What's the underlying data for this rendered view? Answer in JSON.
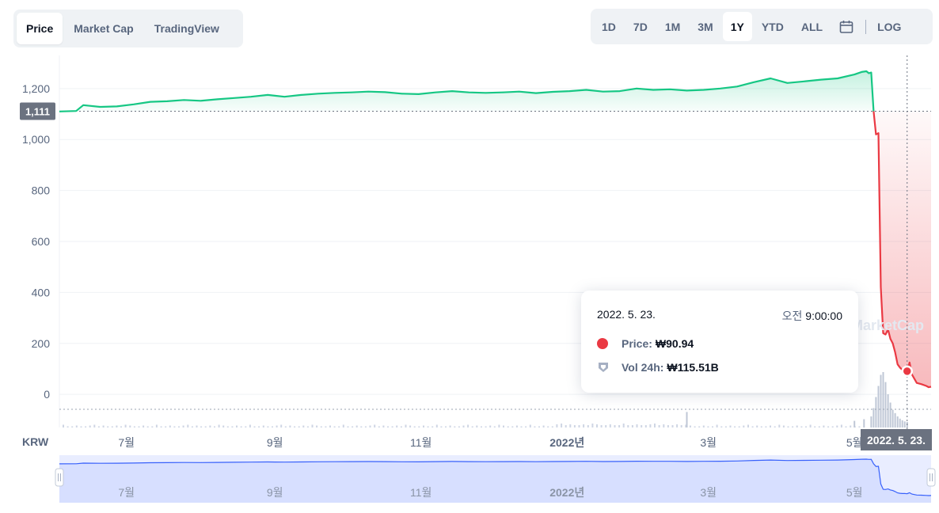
{
  "tabs": [
    {
      "label": "Price",
      "active": true
    },
    {
      "label": "Market Cap",
      "active": false
    },
    {
      "label": "TradingView",
      "active": false
    }
  ],
  "ranges": [
    {
      "label": "1D",
      "active": false
    },
    {
      "label": "7D",
      "active": false
    },
    {
      "label": "1M",
      "active": false
    },
    {
      "label": "3M",
      "active": false
    },
    {
      "label": "1Y",
      "active": true
    },
    {
      "label": "YTD",
      "active": false
    },
    {
      "label": "ALL",
      "active": false
    }
  ],
  "log_label": "LOG",
  "calendar_icon": "calendar-icon",
  "colors": {
    "up": "#16c784",
    "down": "#ea3943",
    "navigator": "#3861fb",
    "grid": "#eff2f5",
    "axis_text": "#58667e"
  },
  "tooltip": {
    "date": "2022. 5. 23.",
    "time_prefix": "오전",
    "time": "9:00:00",
    "price_label": "Price:",
    "price_value": "₩90.94",
    "vol_label": "Vol 24h:",
    "vol_value": "₩115.51B"
  },
  "watermark": "CoinMarketCap",
  "chart_data": {
    "type": "area",
    "currency_label": "KRW",
    "current_price_label": "1,111",
    "crosshair_date_label": "2022. 5. 23.",
    "x_ticks": [
      {
        "label": "7월",
        "date": "2021-07-01"
      },
      {
        "label": "9월",
        "date": "2021-09-01"
      },
      {
        "label": "11월",
        "date": "2021-11-01"
      },
      {
        "label": "2022년",
        "date": "2022-01-01",
        "bold": true
      },
      {
        "label": "3월",
        "date": "2022-03-01"
      },
      {
        "label": "5월",
        "date": "2022-05-01"
      }
    ],
    "y_ticks": [
      0,
      200,
      400,
      600,
      800,
      1000,
      1200
    ],
    "y_tick_labels": [
      "0",
      "200",
      "400",
      "600",
      "800",
      "1,000",
      "1,200"
    ],
    "ylim": [
      -130,
      1330
    ],
    "xlim": [
      "2021-06-03",
      "2022-06-02"
    ],
    "baseline": 1111,
    "grid": true,
    "series": [
      {
        "points": [
          [
            "2021-06-03",
            1110
          ],
          [
            "2021-06-10",
            1112
          ],
          [
            "2021-06-13",
            1135
          ],
          [
            "2021-06-20",
            1128
          ],
          [
            "2021-06-27",
            1130
          ],
          [
            "2021-07-04",
            1138
          ],
          [
            "2021-07-11",
            1148
          ],
          [
            "2021-07-18",
            1150
          ],
          [
            "2021-07-25",
            1155
          ],
          [
            "2021-08-01",
            1152
          ],
          [
            "2021-08-08",
            1158
          ],
          [
            "2021-08-15",
            1163
          ],
          [
            "2021-08-22",
            1168
          ],
          [
            "2021-08-29",
            1175
          ],
          [
            "2021-09-01",
            1172
          ],
          [
            "2021-09-05",
            1168
          ],
          [
            "2021-09-12",
            1175
          ],
          [
            "2021-09-19",
            1180
          ],
          [
            "2021-09-26",
            1183
          ],
          [
            "2021-10-03",
            1185
          ],
          [
            "2021-10-10",
            1188
          ],
          [
            "2021-10-17",
            1186
          ],
          [
            "2021-10-24",
            1180
          ],
          [
            "2021-10-31",
            1178
          ],
          [
            "2021-11-07",
            1185
          ],
          [
            "2021-11-14",
            1190
          ],
          [
            "2021-11-21",
            1185
          ],
          [
            "2021-11-28",
            1183
          ],
          [
            "2021-12-05",
            1185
          ],
          [
            "2021-12-12",
            1188
          ],
          [
            "2021-12-19",
            1182
          ],
          [
            "2021-12-26",
            1187
          ],
          [
            "2022-01-02",
            1190
          ],
          [
            "2022-01-09",
            1195
          ],
          [
            "2022-01-16",
            1188
          ],
          [
            "2022-01-23",
            1190
          ],
          [
            "2022-01-30",
            1200
          ],
          [
            "2022-02-06",
            1195
          ],
          [
            "2022-02-13",
            1197
          ],
          [
            "2022-02-20",
            1192
          ],
          [
            "2022-02-27",
            1195
          ],
          [
            "2022-03-06",
            1200
          ],
          [
            "2022-03-13",
            1208
          ],
          [
            "2022-03-20",
            1225
          ],
          [
            "2022-03-27",
            1240
          ],
          [
            "2022-04-03",
            1222
          ],
          [
            "2022-04-10",
            1228
          ],
          [
            "2022-04-17",
            1235
          ],
          [
            "2022-04-24",
            1240
          ],
          [
            "2022-05-01",
            1255
          ],
          [
            "2022-05-04",
            1265
          ],
          [
            "2022-05-06",
            1268
          ],
          [
            "2022-05-07",
            1260
          ],
          [
            "2022-05-08",
            1263
          ],
          [
            "2022-05-09",
            1111
          ],
          [
            "2022-05-10",
            1020
          ],
          [
            "2022-05-11",
            1025
          ],
          [
            "2022-05-12",
            420
          ],
          [
            "2022-05-13",
            240
          ],
          [
            "2022-05-14",
            235
          ],
          [
            "2022-05-15",
            255
          ],
          [
            "2022-05-16",
            218
          ],
          [
            "2022-05-17",
            200
          ],
          [
            "2022-05-18",
            165
          ],
          [
            "2022-05-19",
            118
          ],
          [
            "2022-05-20",
            105
          ],
          [
            "2022-05-21",
            96
          ],
          [
            "2022-05-22",
            98
          ],
          [
            "2022-05-23",
            90.94
          ],
          [
            "2022-05-24",
            125
          ],
          [
            "2022-05-25",
            78
          ],
          [
            "2022-05-27",
            45
          ],
          [
            "2022-05-29",
            40
          ],
          [
            "2022-05-31",
            33
          ],
          [
            "2022-06-01",
            28
          ],
          [
            "2022-06-02",
            30
          ]
        ]
      }
    ],
    "volume": [
      [
        "2022-02-20",
        0.28
      ],
      [
        "2022-05-01",
        0.12
      ],
      [
        "2022-05-05",
        0.15
      ],
      [
        "2022-05-08",
        0.2
      ],
      [
        "2022-05-09",
        0.35
      ],
      [
        "2022-05-10",
        0.55
      ],
      [
        "2022-05-11",
        0.75
      ],
      [
        "2022-05-12",
        0.95
      ],
      [
        "2022-05-13",
        1.0
      ],
      [
        "2022-05-14",
        0.82
      ],
      [
        "2022-05-15",
        0.6
      ],
      [
        "2022-05-16",
        0.45
      ],
      [
        "2022-05-17",
        0.32
      ],
      [
        "2022-05-18",
        0.26
      ],
      [
        "2022-05-19",
        0.2
      ],
      [
        "2022-05-20",
        0.16
      ],
      [
        "2022-05-21",
        0.13
      ],
      [
        "2022-05-22",
        0.11
      ],
      [
        "2022-05-23",
        0.1
      ]
    ]
  }
}
